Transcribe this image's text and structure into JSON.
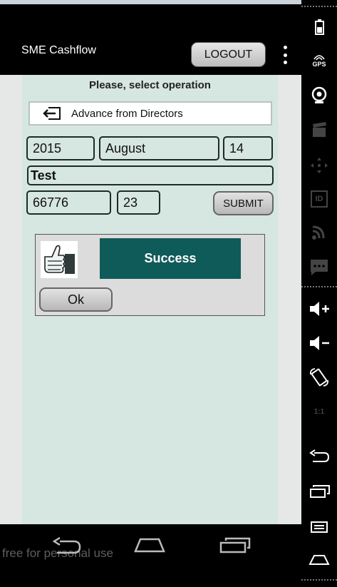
{
  "app": {
    "title": "SME Cashflow",
    "logout_label": "LOGOUT"
  },
  "form": {
    "prompt": "Please, select operation",
    "operation": "Advance from Directors",
    "year": "2015",
    "month": "August",
    "day": "14",
    "description": "Test",
    "amount": "66776",
    "cents": "23",
    "submit_label": "SUBMIT"
  },
  "dialog": {
    "message": "Success",
    "ok_label": "Ok"
  },
  "watermark": "free for personal use",
  "sidebar": {
    "gps_label": "GPS",
    "id_label": "ID",
    "ratio_label": "1:1"
  },
  "colors": {
    "success_bg": "#0f5b5a",
    "panel_bg": "#d6e6e1"
  }
}
